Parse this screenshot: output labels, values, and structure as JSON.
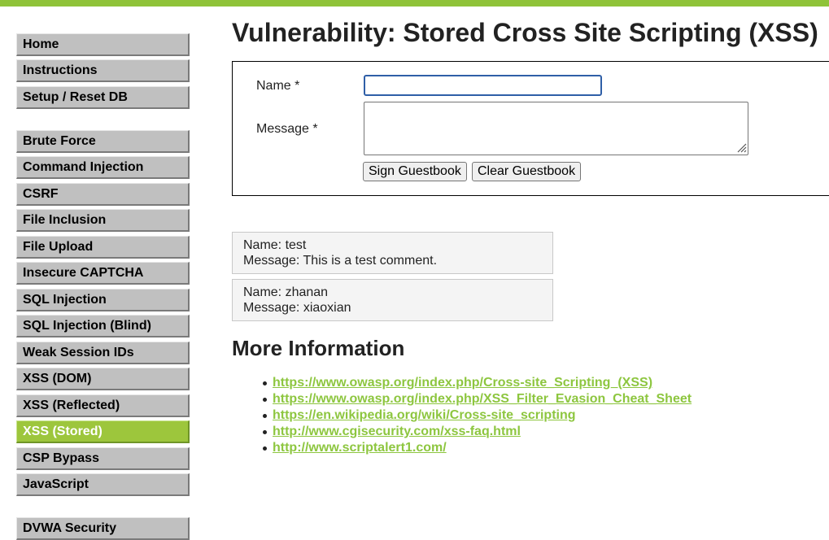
{
  "nav": {
    "group1": [
      "Home",
      "Instructions",
      "Setup / Reset DB"
    ],
    "group2": [
      "Brute Force",
      "Command Injection",
      "CSRF",
      "File Inclusion",
      "File Upload",
      "Insecure CAPTCHA",
      "SQL Injection",
      "SQL Injection (Blind)",
      "Weak Session IDs",
      "XSS (DOM)",
      "XSS (Reflected)",
      "XSS (Stored)",
      "CSP Bypass",
      "JavaScript"
    ],
    "group3": [
      "DVWA Security"
    ],
    "active": "XSS (Stored)"
  },
  "colors": {
    "accent": "#8fc339",
    "active_nav": "#9dc63c",
    "link": "#8dc63f"
  },
  "page": {
    "title": "Vulnerability: Stored Cross Site Scripting (XSS)"
  },
  "form": {
    "name_label": "Name *",
    "name_value": "",
    "message_label": "Message *",
    "message_value": "",
    "sign_button": "Sign Guestbook",
    "clear_button": "Clear Guestbook"
  },
  "entries": [
    {
      "name_line": "Name: test",
      "message_line": "Message: This is a test comment."
    },
    {
      "name_line": "Name: zhanan",
      "message_line": "Message: xiaoxian"
    }
  ],
  "more_info": {
    "title": "More Information",
    "links": [
      "https://www.owasp.org/index.php/Cross-site_Scripting_(XSS)",
      "https://www.owasp.org/index.php/XSS_Filter_Evasion_Cheat_Sheet",
      "https://en.wikipedia.org/wiki/Cross-site_scripting",
      "http://www.cgisecurity.com/xss-faq.html",
      "http://www.scriptalert1.com/"
    ]
  }
}
